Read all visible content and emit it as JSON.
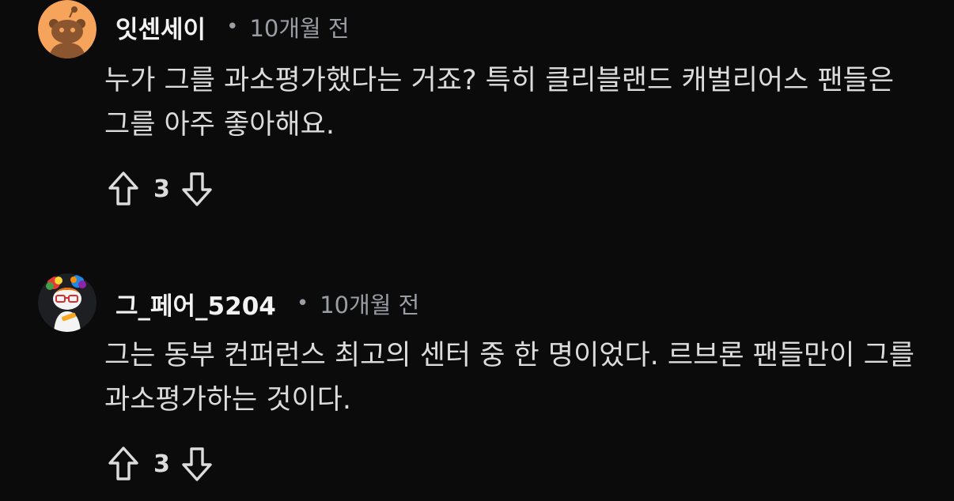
{
  "comments": [
    {
      "username": "잇센세이",
      "separator": "•",
      "time": "10개월 전",
      "text": "누가 그를 과소평가했다는 거죠? 특히 클리블랜드 캐벌리어스 팬들은 그를 아주 좋아해요.",
      "score": "3",
      "avatar": "snoo-avatar-orange"
    },
    {
      "username": "그_페어_5204",
      "separator": "•",
      "time": "10개월 전",
      "text": "그는 동부 컨퍼런스 최고의 센터 중 한 명이었다. 르브론 팬들만이 그를 과소평가하는 것이다.",
      "score": "3",
      "avatar": "snoo-avatar-rainbow-hair"
    }
  ],
  "colors": {
    "background": "#0b0b0c",
    "text": "#dcdcdc",
    "username": "#f2f2f2",
    "meta": "#9a9ea3",
    "avatar1_bg": "#f6a45c"
  }
}
